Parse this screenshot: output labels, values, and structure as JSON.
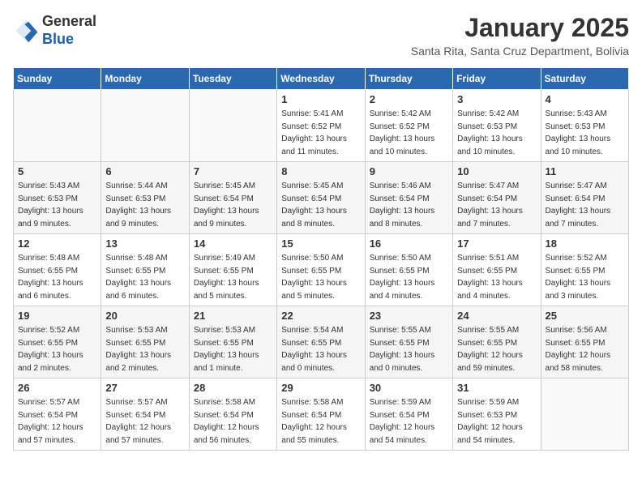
{
  "header": {
    "logo_line1": "General",
    "logo_line2": "Blue",
    "month": "January 2025",
    "location": "Santa Rita, Santa Cruz Department, Bolivia"
  },
  "weekdays": [
    "Sunday",
    "Monday",
    "Tuesday",
    "Wednesday",
    "Thursday",
    "Friday",
    "Saturday"
  ],
  "weeks": [
    [
      {
        "day": "",
        "info": ""
      },
      {
        "day": "",
        "info": ""
      },
      {
        "day": "",
        "info": ""
      },
      {
        "day": "1",
        "info": "Sunrise: 5:41 AM\nSunset: 6:52 PM\nDaylight: 13 hours\nand 11 minutes."
      },
      {
        "day": "2",
        "info": "Sunrise: 5:42 AM\nSunset: 6:52 PM\nDaylight: 13 hours\nand 10 minutes."
      },
      {
        "day": "3",
        "info": "Sunrise: 5:42 AM\nSunset: 6:53 PM\nDaylight: 13 hours\nand 10 minutes."
      },
      {
        "day": "4",
        "info": "Sunrise: 5:43 AM\nSunset: 6:53 PM\nDaylight: 13 hours\nand 10 minutes."
      }
    ],
    [
      {
        "day": "5",
        "info": "Sunrise: 5:43 AM\nSunset: 6:53 PM\nDaylight: 13 hours\nand 9 minutes."
      },
      {
        "day": "6",
        "info": "Sunrise: 5:44 AM\nSunset: 6:53 PM\nDaylight: 13 hours\nand 9 minutes."
      },
      {
        "day": "7",
        "info": "Sunrise: 5:45 AM\nSunset: 6:54 PM\nDaylight: 13 hours\nand 9 minutes."
      },
      {
        "day": "8",
        "info": "Sunrise: 5:45 AM\nSunset: 6:54 PM\nDaylight: 13 hours\nand 8 minutes."
      },
      {
        "day": "9",
        "info": "Sunrise: 5:46 AM\nSunset: 6:54 PM\nDaylight: 13 hours\nand 8 minutes."
      },
      {
        "day": "10",
        "info": "Sunrise: 5:47 AM\nSunset: 6:54 PM\nDaylight: 13 hours\nand 7 minutes."
      },
      {
        "day": "11",
        "info": "Sunrise: 5:47 AM\nSunset: 6:54 PM\nDaylight: 13 hours\nand 7 minutes."
      }
    ],
    [
      {
        "day": "12",
        "info": "Sunrise: 5:48 AM\nSunset: 6:55 PM\nDaylight: 13 hours\nand 6 minutes."
      },
      {
        "day": "13",
        "info": "Sunrise: 5:48 AM\nSunset: 6:55 PM\nDaylight: 13 hours\nand 6 minutes."
      },
      {
        "day": "14",
        "info": "Sunrise: 5:49 AM\nSunset: 6:55 PM\nDaylight: 13 hours\nand 5 minutes."
      },
      {
        "day": "15",
        "info": "Sunrise: 5:50 AM\nSunset: 6:55 PM\nDaylight: 13 hours\nand 5 minutes."
      },
      {
        "day": "16",
        "info": "Sunrise: 5:50 AM\nSunset: 6:55 PM\nDaylight: 13 hours\nand 4 minutes."
      },
      {
        "day": "17",
        "info": "Sunrise: 5:51 AM\nSunset: 6:55 PM\nDaylight: 13 hours\nand 4 minutes."
      },
      {
        "day": "18",
        "info": "Sunrise: 5:52 AM\nSunset: 6:55 PM\nDaylight: 13 hours\nand 3 minutes."
      }
    ],
    [
      {
        "day": "19",
        "info": "Sunrise: 5:52 AM\nSunset: 6:55 PM\nDaylight: 13 hours\nand 2 minutes."
      },
      {
        "day": "20",
        "info": "Sunrise: 5:53 AM\nSunset: 6:55 PM\nDaylight: 13 hours\nand 2 minutes."
      },
      {
        "day": "21",
        "info": "Sunrise: 5:53 AM\nSunset: 6:55 PM\nDaylight: 13 hours\nand 1 minute."
      },
      {
        "day": "22",
        "info": "Sunrise: 5:54 AM\nSunset: 6:55 PM\nDaylight: 13 hours\nand 0 minutes."
      },
      {
        "day": "23",
        "info": "Sunrise: 5:55 AM\nSunset: 6:55 PM\nDaylight: 13 hours\nand 0 minutes."
      },
      {
        "day": "24",
        "info": "Sunrise: 5:55 AM\nSunset: 6:55 PM\nDaylight: 12 hours\nand 59 minutes."
      },
      {
        "day": "25",
        "info": "Sunrise: 5:56 AM\nSunset: 6:55 PM\nDaylight: 12 hours\nand 58 minutes."
      }
    ],
    [
      {
        "day": "26",
        "info": "Sunrise: 5:57 AM\nSunset: 6:54 PM\nDaylight: 12 hours\nand 57 minutes."
      },
      {
        "day": "27",
        "info": "Sunrise: 5:57 AM\nSunset: 6:54 PM\nDaylight: 12 hours\nand 57 minutes."
      },
      {
        "day": "28",
        "info": "Sunrise: 5:58 AM\nSunset: 6:54 PM\nDaylight: 12 hours\nand 56 minutes."
      },
      {
        "day": "29",
        "info": "Sunrise: 5:58 AM\nSunset: 6:54 PM\nDaylight: 12 hours\nand 55 minutes."
      },
      {
        "day": "30",
        "info": "Sunrise: 5:59 AM\nSunset: 6:54 PM\nDaylight: 12 hours\nand 54 minutes."
      },
      {
        "day": "31",
        "info": "Sunrise: 5:59 AM\nSunset: 6:53 PM\nDaylight: 12 hours\nand 54 minutes."
      },
      {
        "day": "",
        "info": ""
      }
    ]
  ]
}
